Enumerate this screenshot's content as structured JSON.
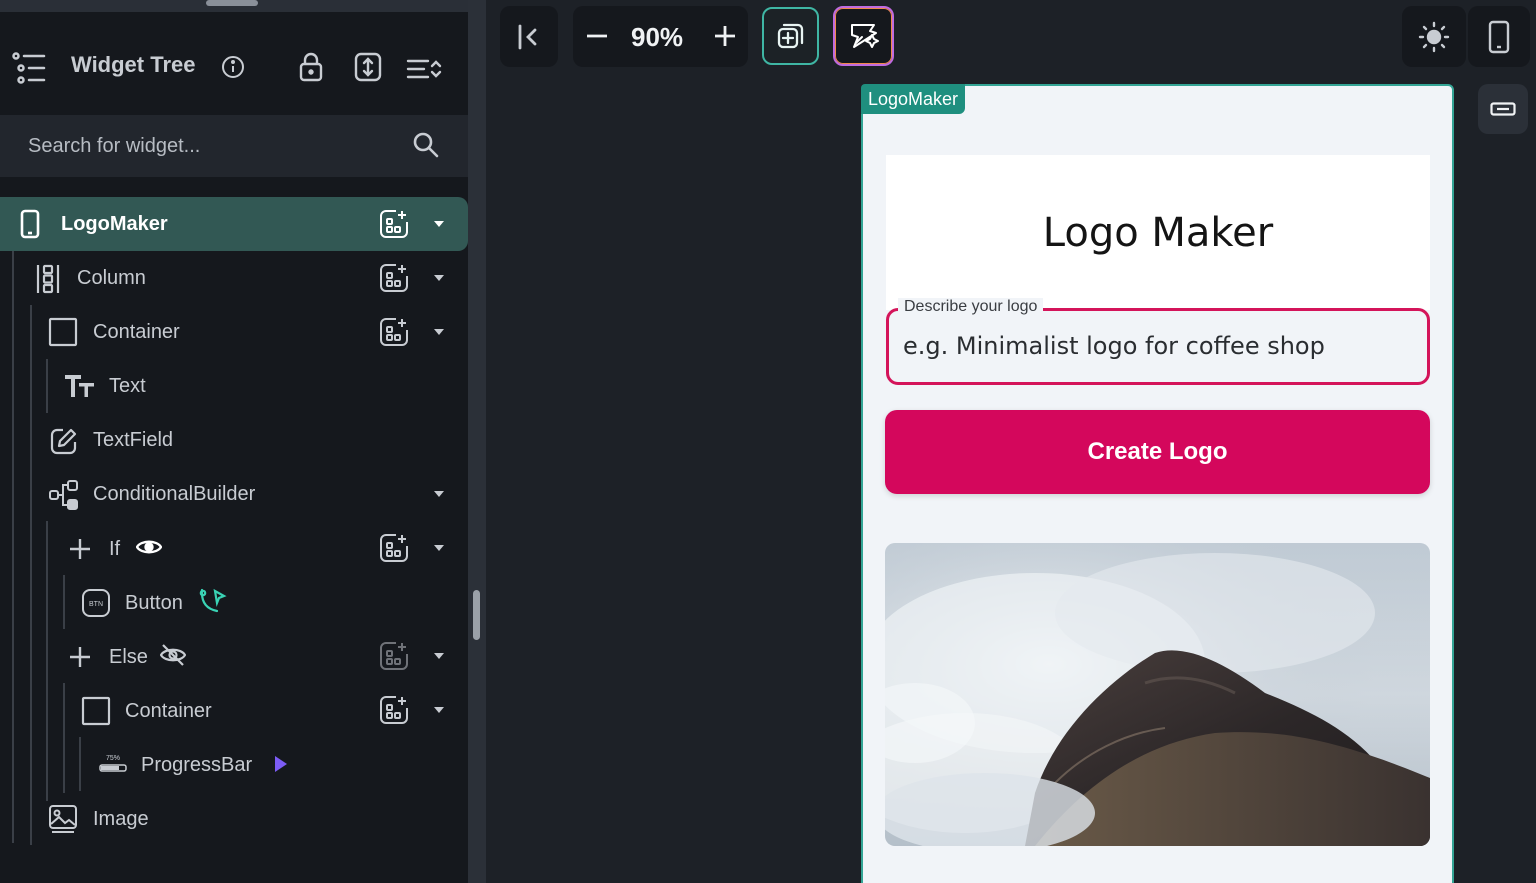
{
  "sidebar": {
    "title": "Widget Tree",
    "search_placeholder": "Search for widget...",
    "tree": [
      {
        "label": "LogoMaker"
      },
      {
        "label": "Column"
      },
      {
        "label": "Container"
      },
      {
        "label": "Text"
      },
      {
        "label": "TextField"
      },
      {
        "label": "ConditionalBuilder"
      },
      {
        "label": "If"
      },
      {
        "label": "Button"
      },
      {
        "label": "Else"
      },
      {
        "label": "Container"
      },
      {
        "label": "ProgressBar"
      },
      {
        "label": "Image"
      }
    ]
  },
  "toolbar": {
    "zoom": "90%"
  },
  "canvas": {
    "page_tag": "LogoMaker",
    "app_title": "Logo Maker",
    "field_label": "Describe your logo",
    "field_placeholder": "e.g. Minimalist logo for coffee shop",
    "button_label": "Create Logo"
  },
  "colors": {
    "accent": "#d4075c",
    "selected_row": "#325854",
    "teal": "#34a595"
  },
  "icons": [
    "list-icon",
    "info-icon",
    "lock-icon",
    "expand-vertical-icon",
    "sort-icon",
    "search-icon",
    "phone-icon",
    "column-icon",
    "container-icon",
    "text-icon",
    "textfield-icon",
    "conditional-icon",
    "add-widget-icon",
    "plus-icon",
    "eye-icon",
    "eye-off-icon",
    "btn-icon",
    "action-icon",
    "progressbar-icon",
    "image-icon",
    "collapse-left-icon",
    "minus-icon",
    "add-page-icon",
    "magic-icon",
    "sun-icon",
    "device-icon",
    "keyboard-icon"
  ]
}
